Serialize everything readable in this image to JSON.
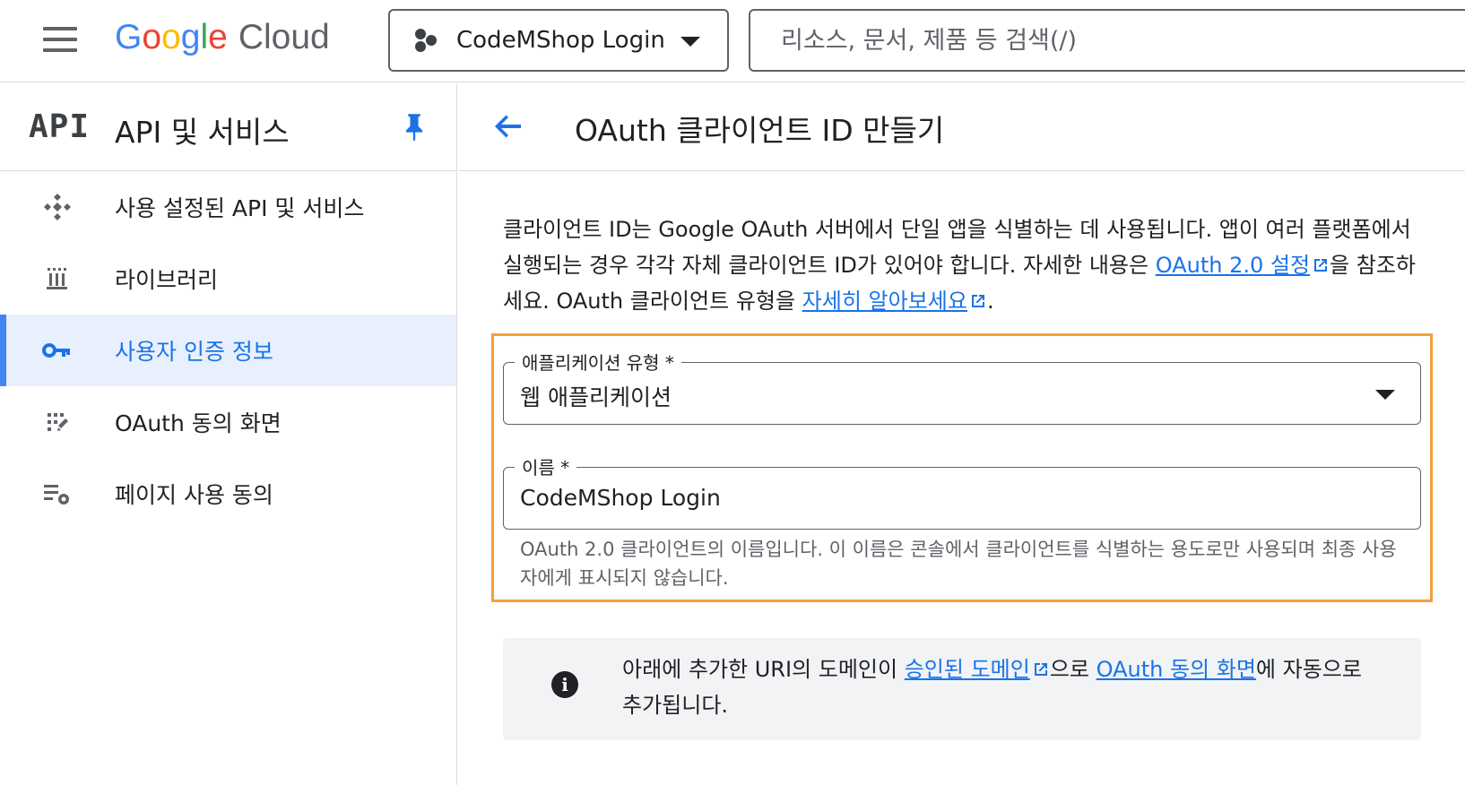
{
  "topbar": {
    "logo_letters": [
      "G",
      "o",
      "o",
      "g",
      "l",
      "e"
    ],
    "logo_product": "Cloud",
    "project": "CodeMShop Login",
    "search_placeholder": "리소스, 문서, 제품 등 검색(/)"
  },
  "sidebar": {
    "api_badge": "API",
    "title": "API 및 서비스",
    "items": [
      {
        "label": "사용 설정된 API 및 서비스",
        "icon": "diamond-api-icon",
        "active": false
      },
      {
        "label": "라이브러리",
        "icon": "library-icon",
        "active": false
      },
      {
        "label": "사용자 인증 정보",
        "icon": "key-icon",
        "active": true
      },
      {
        "label": "OAuth 동의 화면",
        "icon": "consent-dots-icon",
        "active": false
      },
      {
        "label": "페이지 사용 동의",
        "icon": "settings-list-icon",
        "active": false
      }
    ]
  },
  "main": {
    "title": "OAuth 클라이언트 ID 만들기",
    "desc_part1": "클라이언트 ID는 Google OAuth 서버에서 단일 앱을 식별하는 데 사용됩니다. 앱이 여러 플랫폼에서 실행되는 경우 각각 자체 클라이언트 ID가 있어야 합니다. 자세한 내용은 ",
    "desc_link1": "OAuth 2.0 설정",
    "desc_part2": "을 참조하세요. OAuth 클라이언트 유형을 ",
    "desc_link2": "자세히 알아보세요",
    "desc_part3": ".",
    "app_type_label": "애플리케이션 유형 *",
    "app_type_value": "웹 애플리케이션",
    "name_label": "이름 *",
    "name_value": "CodeMShop Login",
    "name_hint": "OAuth 2.0 클라이언트의 이름입니다. 이 이름은 콘솔에서 클라이언트를 식별하는 용도로만 사용되며 최종 사용자에게 표시되지 않습니다.",
    "info_part1": "아래에 추가한 URI의 도메인이 ",
    "info_link1": "승인된 도메인",
    "info_part2": "으로 ",
    "info_link2": "OAuth 동의 화면",
    "info_part3": "에 자동으로 추가됩니다.",
    "info_icon_glyph": "i"
  },
  "colors": {
    "accent": "#1a73e8",
    "highlight": "#f4a03a",
    "active_bg": "#e8f0fe"
  }
}
